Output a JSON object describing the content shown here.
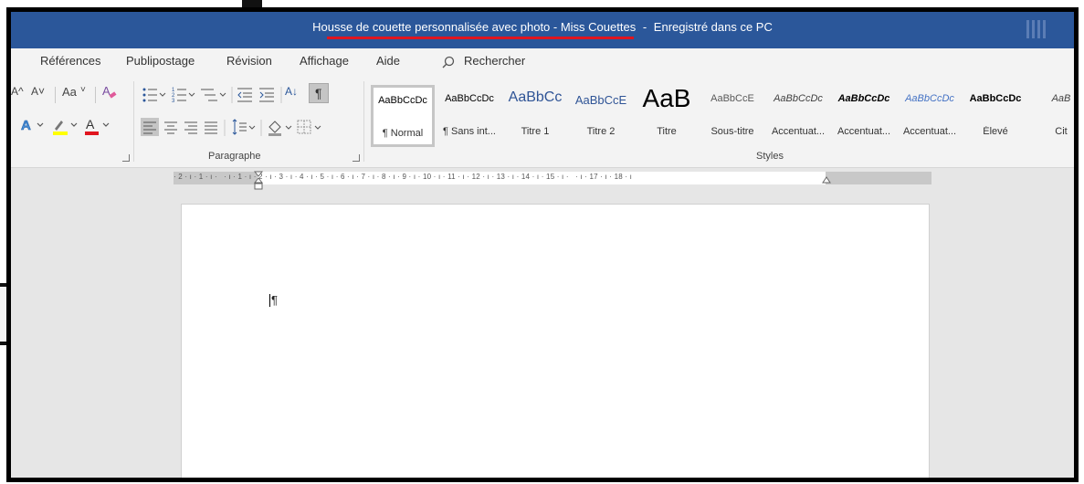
{
  "window": {
    "title_doc": "Housse de couette personnalisée avec photo - Miss Couettes",
    "title_sep": "-",
    "title_status": "Enregistré dans ce PC"
  },
  "tabs": [
    "Références",
    "Publipostage",
    "Révision",
    "Affichage",
    "Aide"
  ],
  "search": {
    "label": "Rechercher"
  },
  "font_controls": {
    "grow": "A^",
    "shrink": "A˅",
    "case": "Aa",
    "case_arrow": "˅",
    "clear": "A"
  },
  "paragraph": {
    "group_label": "Paragraphe",
    "sort": "A↓",
    "show_marks": "¶"
  },
  "styles": {
    "group_label": "Styles",
    "items": [
      {
        "preview": "AaBbCcDc",
        "name": "¶ Normal",
        "color": "#000000",
        "style": "normal",
        "weight": "normal",
        "size": "11px"
      },
      {
        "preview": "AaBbCcDc",
        "name": "¶ Sans int...",
        "color": "#000000",
        "style": "normal",
        "weight": "normal",
        "size": "11px"
      },
      {
        "preview": "AaBbCc",
        "name": "Titre 1",
        "color": "#2f5496",
        "style": "normal",
        "weight": "normal",
        "size": "16px"
      },
      {
        "preview": "AaBbCcE",
        "name": "Titre 2",
        "color": "#2f5496",
        "style": "normal",
        "weight": "normal",
        "size": "13px"
      },
      {
        "preview": "AaB",
        "name": "Titre",
        "color": "#000000",
        "style": "normal",
        "weight": "normal",
        "size": "28px"
      },
      {
        "preview": "AaBbCcE",
        "name": "Sous-titre",
        "color": "#595959",
        "style": "normal",
        "weight": "normal",
        "size": "11px"
      },
      {
        "preview": "AaBbCcDc",
        "name": "Accentuat...",
        "color": "#404040",
        "style": "italic",
        "weight": "normal",
        "size": "11px"
      },
      {
        "preview": "AaBbCcDc",
        "name": "Accentuat...",
        "color": "#000000",
        "style": "italic",
        "weight": "bold",
        "size": "11px"
      },
      {
        "preview": "AaBbCcDc",
        "name": "Accentuat...",
        "color": "#4472c4",
        "style": "italic",
        "weight": "normal",
        "size": "11px"
      },
      {
        "preview": "AaBbCcDc",
        "name": "Élevé",
        "color": "#000000",
        "style": "normal",
        "weight": "bold",
        "size": "11px"
      },
      {
        "preview": "AaB",
        "name": "Cit",
        "color": "#404040",
        "style": "italic",
        "weight": "normal",
        "size": "11px"
      }
    ]
  },
  "ruler": {
    "text": "· 2 · ı · 1 · ı ·   · ı · 1 · ı · 2 · ı · 3 · ı · 4 · ı · 5 · ı · 6 · ı · 7 · ı · 8 · ı · 9 · ı · 10 · ı · 11 · ı · 12 · ı · 13 · ı · 14 · ı · 15 · ı ·   · ı · 17 · ı · 18 · ı"
  },
  "document": {
    "pilcrow": "¶"
  },
  "colors": {
    "titlebar": "#2b579a",
    "accent_underline": "#e0151f",
    "highlight": "#ffff00",
    "font_color": "#e0151f"
  }
}
